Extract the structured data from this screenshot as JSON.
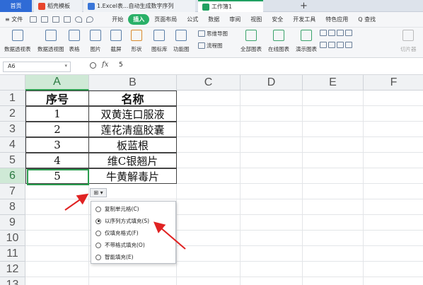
{
  "tabs": {
    "home": "首页",
    "templates": "稻壳模板",
    "doc": "1.Excel表...自动生成数字序列",
    "workbook": "工作簿1",
    "new_tab": "+"
  },
  "menu": {
    "file": "≡ 文件",
    "items": [
      "开始",
      "插入",
      "页面布局",
      "公式",
      "数据",
      "审阅",
      "视图",
      "安全",
      "开发工具",
      "特色应用"
    ],
    "active": "插入",
    "search": "Q 查找"
  },
  "toolbar": {
    "pivot_table": "数据透视表",
    "pivot_chart": "数据透视图",
    "table": "表格",
    "picture": "图片",
    "screenshot": "截屏",
    "shapes": "形状",
    "icon_lib": "图标库",
    "func_chart": "功能图",
    "mindmap": "思维导图",
    "flowchart": "流程图",
    "all_charts": "全部图表",
    "online_charts": "在线图表",
    "demo_charts": "演示图表",
    "slicer": "切片器"
  },
  "formula_bar": {
    "cell_ref": "A6",
    "fx": "fx",
    "value": "5"
  },
  "grid": {
    "columns": [
      "A",
      "B",
      "C",
      "D",
      "E",
      "F"
    ],
    "rows": [
      "1",
      "2",
      "3",
      "4",
      "5",
      "6",
      "7",
      "8",
      "9",
      "10",
      "11",
      "12",
      "13"
    ],
    "header": {
      "a": "序号",
      "b": "名称"
    },
    "data": [
      {
        "a": "1",
        "b": "双黄连口服液"
      },
      {
        "a": "2",
        "b": "莲花清瘟胶囊"
      },
      {
        "a": "3",
        "b": "板蓝根"
      },
      {
        "a": "4",
        "b": "维C银翘片"
      },
      {
        "a": "5",
        "b": "牛黄解毒片"
      }
    ]
  },
  "autofill": {
    "button": "⊞ ▾",
    "options": [
      "复制单元格(C)",
      "以序列方式填充(S)",
      "仅填充格式(F)",
      "不带格式填充(O)",
      "智能填充(E)"
    ],
    "selected_index": 1
  },
  "colors": {
    "accent": "#2a9d4e",
    "arrow": "#e02222",
    "tab_blue": "#2f6bd6"
  }
}
